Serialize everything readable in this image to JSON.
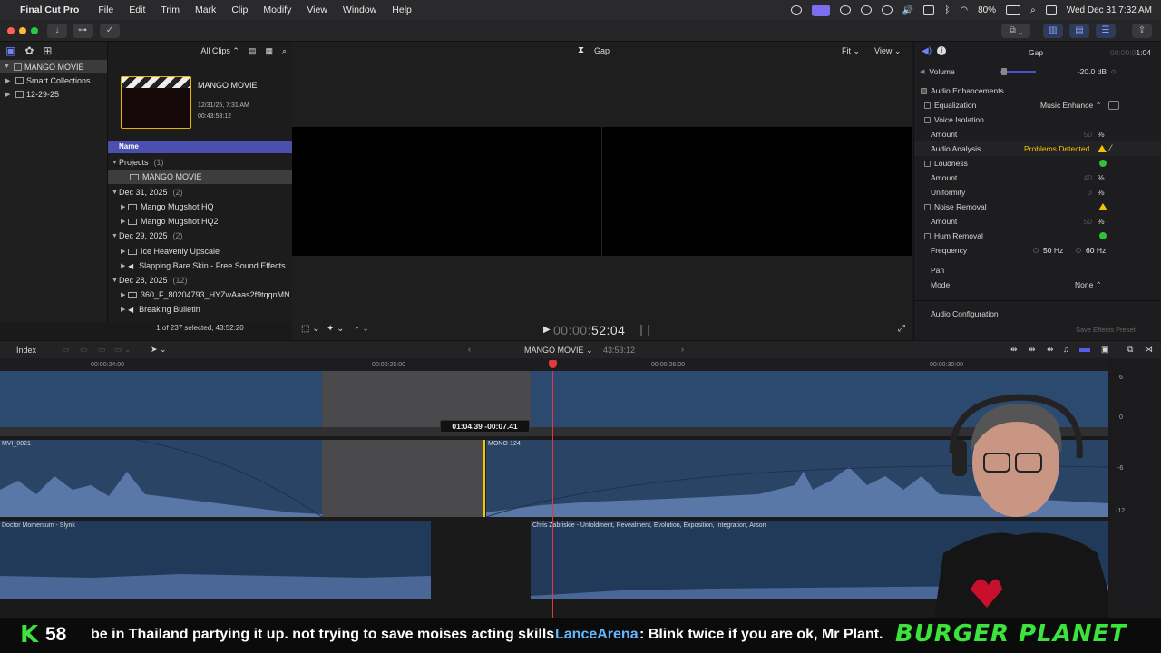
{
  "menubar": {
    "app_name": "Final Cut Pro",
    "items": [
      "File",
      "Edit",
      "Trim",
      "Mark",
      "Clip",
      "Modify",
      "View",
      "Window",
      "Help"
    ],
    "battery": "80%",
    "datetime": "Wed Dec 31  7:32 AM"
  },
  "library": {
    "items": [
      {
        "label": "MANGO MOVIE",
        "selected": true
      },
      {
        "label": "Smart Collections"
      },
      {
        "label": "12-29-25"
      }
    ]
  },
  "browser": {
    "filter": "All Clips",
    "project_card": {
      "title": "MANGO MOVIE",
      "date": "12/31/25, 7:31 AM",
      "duration": "00:43:53:12"
    },
    "column_header": "Name",
    "rows": [
      {
        "label": "Projects",
        "count": "(1)",
        "type": "group"
      },
      {
        "label": "MANGO MOVIE",
        "type": "project",
        "selected": true
      },
      {
        "label": "Dec 31, 2025",
        "count": "(2)",
        "type": "group"
      },
      {
        "label": "Mango Mugshot HQ",
        "type": "clip"
      },
      {
        "label": "Mango Mugshot HQ2",
        "type": "clip"
      },
      {
        "label": "Dec 29, 2025",
        "count": "(2)",
        "type": "group"
      },
      {
        "label": "Ice Heavenly Upscale",
        "type": "clip"
      },
      {
        "label": "Slapping Bare Skin - Free Sound Effects",
        "type": "audio"
      },
      {
        "label": "Dec 28, 2025",
        "count": "(12)",
        "type": "group"
      },
      {
        "label": "360_F_80204793_HYZwAaas2f9tqqnMN",
        "type": "clip"
      },
      {
        "label": "Breaking Bulletin",
        "type": "audio"
      }
    ],
    "status": "1 of 237 selected, 43:52:20"
  },
  "viewer": {
    "title": "Gap",
    "fit": "Fit",
    "view": "View",
    "timecode_dim": "00:00:",
    "timecode_bright": "52:04"
  },
  "inspector": {
    "title": "Gap",
    "duration_dim": "00:00:0",
    "duration": "1:04",
    "volume_label": "Volume",
    "volume_value": "-20.0",
    "volume_unit": "dB",
    "section": "Audio Enhancements",
    "eq_label": "Equalization",
    "eq_value": "Music Enhance",
    "voice_isolation": "Voice Isolation",
    "amount": "Amount",
    "vi_amount": "50",
    "percent": "%",
    "analysis_label": "Audio Analysis",
    "analysis_value": "Problems Detected",
    "loudness": "Loudness",
    "loud_amount": "40",
    "uniformity": "Uniformity",
    "uniformity_value": "3",
    "noise_removal": "Noise Removal",
    "noise_amount": "50",
    "hum_removal": "Hum Removal",
    "frequency": "Frequency",
    "freq_50": "50",
    "freq_60": "60",
    "hz": "Hz",
    "pan": "Pan",
    "mode": "Mode",
    "mode_value": "None",
    "audio_config": "Audio Configuration",
    "save_preset": "Save Effects Preset"
  },
  "timeline": {
    "index": "Index",
    "project": "MANGO MOVIE",
    "duration": "43:53:12",
    "ruler": [
      "00:00:24:00",
      "00:00:25:00",
      "00:00:26:00",
      "00:00:30:00"
    ],
    "trim_tooltip": "01:04.39  -00:07.41",
    "clips": {
      "a": "MVI_0021",
      "b": "MONO-124",
      "c": "Doctor Momentum - Slynk",
      "d": "Chris Zabriskie - Unfoldment, Revealment, Evolution, Exposition, Integration, Arson"
    },
    "meter_labels": [
      "6",
      "0",
      "-6",
      "-12"
    ]
  },
  "overlay": {
    "count_letter": "K",
    "count": "58",
    "chat_text": "be in Thailand partying it up. not trying to save moises acting skills",
    "chat_user": "LanceArena",
    "chat_msg": ": Blink twice if you are ok, Mr Plant.",
    "brand": "BURGER PLANET"
  },
  "colors": {
    "accent_blue": "#4b4fb0",
    "selection_yellow": "#e8b600",
    "audio_clip": "#2a4466",
    "playhead": "#e0393e",
    "brand_green": "#3ce33c"
  }
}
